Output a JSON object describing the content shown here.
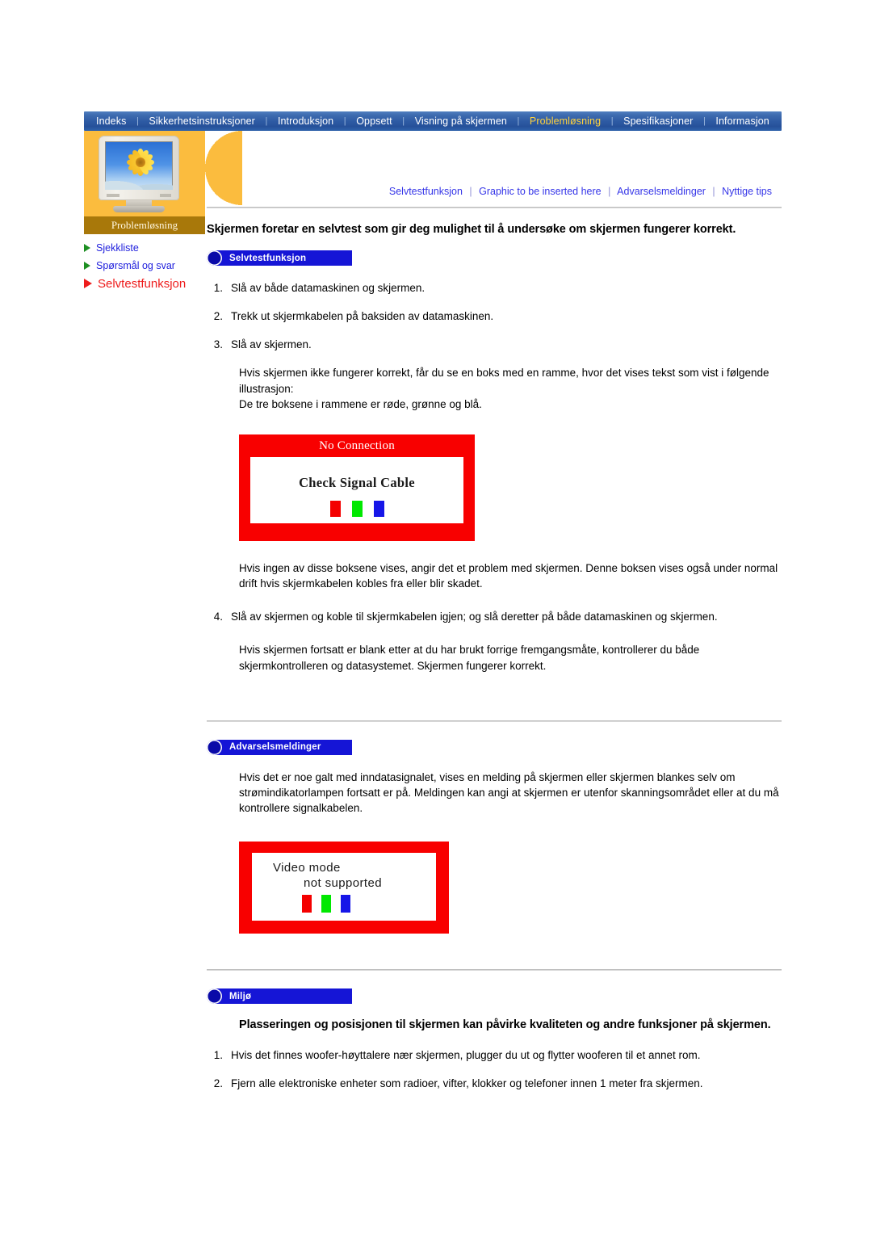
{
  "nav": {
    "separator": "|",
    "items": [
      {
        "label": "Indeks",
        "active": false
      },
      {
        "label": "Sikkerhetsinstruksjoner",
        "active": false
      },
      {
        "label": "Introduksjon",
        "active": false
      },
      {
        "label": "Oppsett",
        "active": false
      },
      {
        "label": "Visning på skjermen",
        "active": false
      },
      {
        "label": "Problemløsning",
        "active": true
      },
      {
        "label": "Spesifikasjoner",
        "active": false
      },
      {
        "label": "Informasjon",
        "active": false
      }
    ],
    "active_color": "#ffd23c",
    "bar_color": "#2e5ba4"
  },
  "sidebar": {
    "thumbnail_name": "monitor-sunflower-thumbnail",
    "caption": "Problemløsning",
    "caption_bg": "#a8780a",
    "panel_bg": "#fbbc3e",
    "links": [
      {
        "label": "Sjekkliste",
        "active": false,
        "bullet": "green-triangle-icon"
      },
      {
        "label": "Spørsmål og svar",
        "active": false,
        "bullet": "green-triangle-icon"
      },
      {
        "label": "Selvtestfunksjon",
        "active": true,
        "bullet": "red-triangle-icon"
      }
    ],
    "link_color": "#2020dd",
    "active_link_color": "#ee1c1c"
  },
  "subnav": {
    "separator": "|",
    "items": [
      {
        "label": "Selvtestfunksjon"
      },
      {
        "label": "Graphic to be inserted here"
      },
      {
        "label": "Advarselsmeldinger"
      },
      {
        "label": "Nyttige tips"
      }
    ],
    "color": "#3535e8"
  },
  "main": {
    "heading": "Skjermen foretar en selvtest som gir deg mulighet til å undersøke om skjermen fungerer korrekt.",
    "section1": {
      "badge": "Selvtestfunksjon",
      "steps": [
        {
          "num": "1.",
          "text": "Slå av både datamaskinen og skjermen."
        },
        {
          "num": "2.",
          "text": "Trekk ut skjermkabelen på baksiden av datamaskinen."
        },
        {
          "num": "3.",
          "text": "Slå av skjermen."
        }
      ],
      "para_after_steps_line1": "Hvis skjermen ikke fungerer korrekt, får du se en boks med en ramme, hvor det vises tekst som vist i følgende illustrasjon:",
      "para_after_steps_line2": "De tre boksene i rammene er røde, grønne og blå.",
      "graphic1": {
        "name": "no-connection-error-graphic",
        "title": "No Connection",
        "message": "Check Signal Cable",
        "border_color": "#f80000",
        "swatches": [
          "#f40000",
          "#00e800",
          "#1616e8"
        ]
      },
      "para_after_graphic": "Hvis ingen av disse boksene vises, angir det et problem med skjermen. Denne boksen vises også under normal drift hvis skjermkabelen kobles fra eller blir skadet.",
      "step4": {
        "num": "4.",
        "text": "Slå av skjermen og koble til skjermkabelen igjen; og slå deretter på både datamaskinen og skjermen."
      },
      "para_final": "Hvis skjermen fortsatt er blank etter at du har brukt forrige fremgangsmåte, kontrollerer du både skjermkontrolleren og datasystemet. Skjermen fungerer korrekt."
    },
    "section2": {
      "badge": "Advarselsmeldinger",
      "para": "Hvis det er noe galt med inndatasignalet, vises en melding på skjermen eller skjermen blankes selv om strømindikatorlampen fortsatt er på. Meldingen kan angi at skjermen er utenfor skanningsområdet eller at du må kontrollere signalkabelen.",
      "graphic2": {
        "name": "video-mode-not-supported-graphic",
        "line1": "Video mode",
        "line2": "not  supported",
        "border_color": "#f80000",
        "swatches": [
          "#f40000",
          "#00e800",
          "#1616e8"
        ]
      }
    },
    "section3": {
      "badge": "Miljø",
      "heading": "Plasseringen og posisjonen til skjermen kan påvirke kvaliteten og andre funksjoner på skjermen.",
      "steps": [
        {
          "num": "1.",
          "text": "Hvis det finnes woofer-høyttalere nær skjermen, plugger du ut og flytter wooferen til et annet rom."
        },
        {
          "num": "2.",
          "text": "Fjern alle elektroniske enheter som radioer, vifter, klokker og telefoner innen 1 meter fra skjermen."
        }
      ]
    }
  }
}
